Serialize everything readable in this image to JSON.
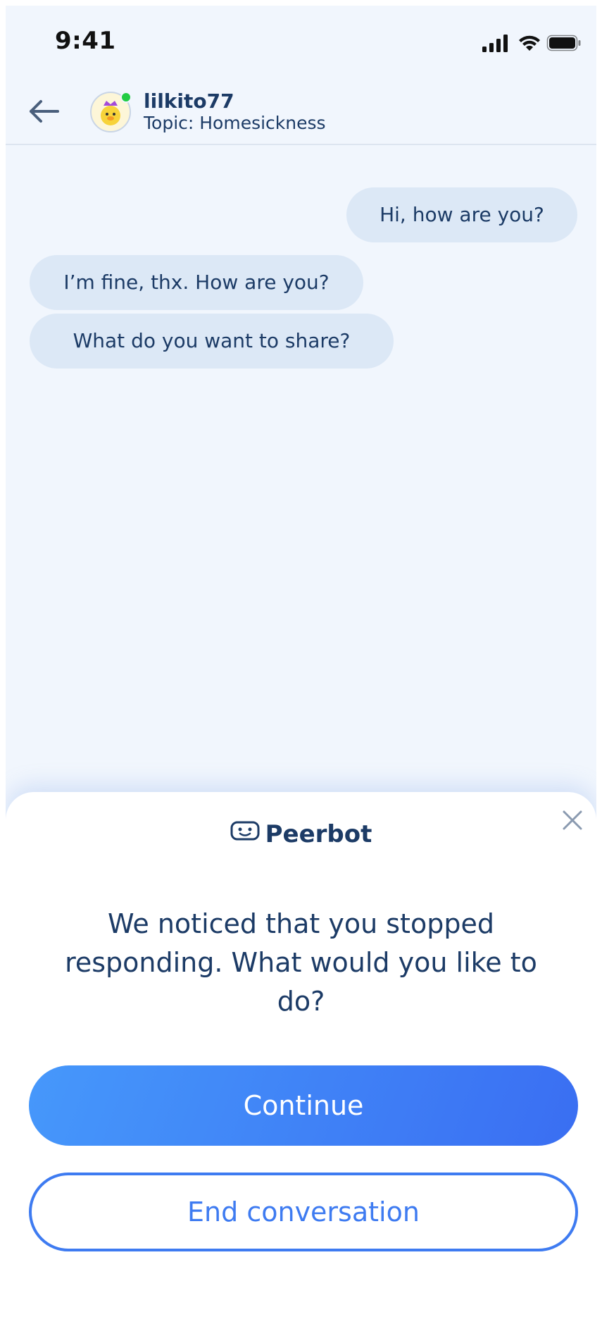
{
  "status_bar": {
    "time": "9:41"
  },
  "header": {
    "username": "lilkito77",
    "topic": "Topic: Homesickness",
    "online": true
  },
  "messages": [
    {
      "sender": "me",
      "text": "Hi, how are you?"
    },
    {
      "sender": "peer",
      "text": "I’m fine, thx. How are you?"
    },
    {
      "sender": "peer",
      "text": "What do you want to share?"
    }
  ],
  "sheet": {
    "title": "Peerbot",
    "message": "We noticed that you stopped responding. What would you like to do?",
    "continue_label": "Continue",
    "end_label": "End conversation"
  },
  "colors": {
    "background": "#f1f6fd",
    "bubble": "#dce8f6",
    "text_dark": "#1c3b66",
    "accent_blue": "#3e7bf1",
    "online_green": "#22cc44"
  },
  "icons": {
    "back": "arrow-left-icon",
    "close": "close-icon",
    "bot": "robot-icon",
    "signal": "cellular-signal-icon",
    "wifi": "wifi-icon",
    "battery": "battery-icon"
  }
}
